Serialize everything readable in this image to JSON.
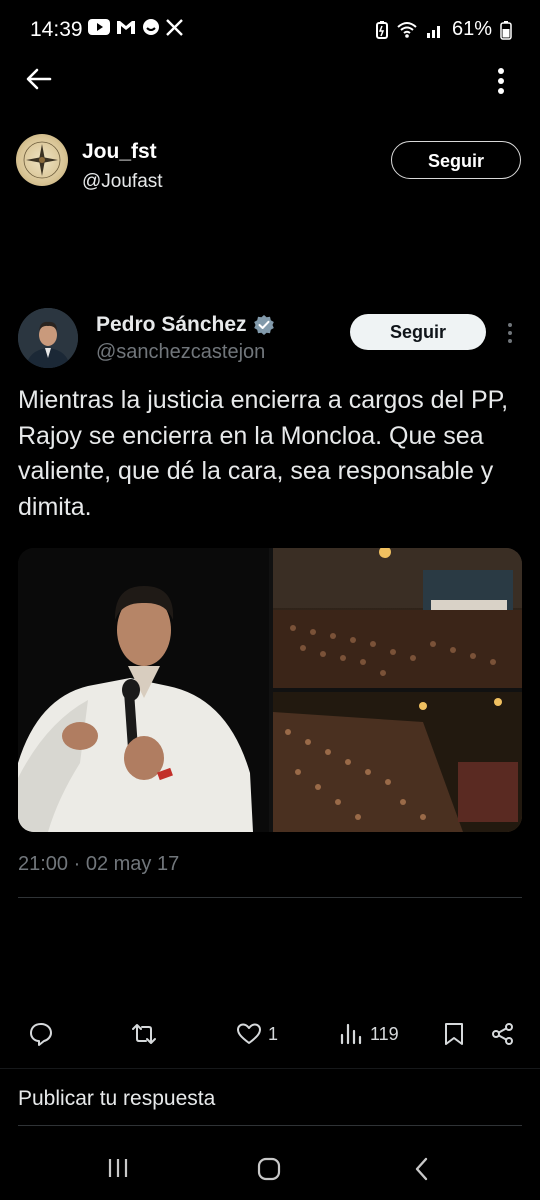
{
  "status_bar": {
    "time": "14:39",
    "battery": "61%",
    "notification_icons": [
      "youtube-icon",
      "gmail-icon",
      "chat-icon",
      "x-icon"
    ],
    "system_icons": [
      "battery-saver-icon",
      "wifi-icon",
      "signal-icon",
      "battery-icon"
    ]
  },
  "nav": {
    "back_icon": "arrow-left-icon",
    "more_icon": "vertical-dots-icon"
  },
  "suggested_account": {
    "name": "Jou_fst",
    "handle": "@Joufast",
    "follow_label": "Seguir"
  },
  "tweet": {
    "author_name": "Pedro Sánchez",
    "author_handle": "@sanchezcastejon",
    "follow_label": "Seguir",
    "verified": true,
    "text": "Mientras la justicia encierra a cargos del PP, Rajoy se encierra en la Moncloa. Que sea valiente, que dé la cara, sea responsable y dimita.",
    "timestamp": "21:00 · 02 may 17",
    "media_count": 3
  },
  "actions": {
    "reply_icon": "reply-icon",
    "retweet_icon": "retweet-icon",
    "like_icon": "heart-icon",
    "likes": "1",
    "views_icon": "views-icon",
    "views": "119",
    "bookmark_icon": "bookmark-icon",
    "share_icon": "share-icon"
  },
  "reply_placeholder": "Publicar tu respuesta",
  "android_nav": [
    "recents-icon",
    "home-icon",
    "back-icon"
  ],
  "colors": {
    "background": "#000000",
    "text_primary": "#e7e9ea",
    "text_secondary": "#71767b",
    "verified": "#829aab",
    "divider": "#2f3336"
  }
}
